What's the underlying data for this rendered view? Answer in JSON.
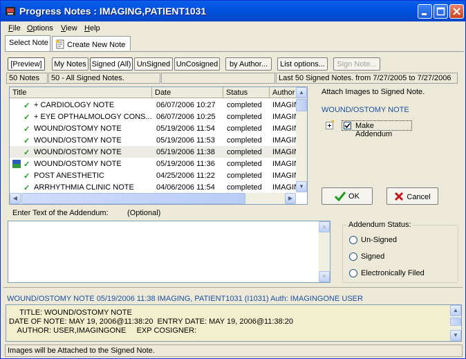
{
  "window": {
    "title": "Progress Notes : IMAGING,PATIENT1031"
  },
  "menu": [
    {
      "key": "F",
      "rest": "ile"
    },
    {
      "key": "O",
      "rest": "ptions"
    },
    {
      "key": "V",
      "rest": "iew"
    },
    {
      "key": "H",
      "rest": "elp"
    }
  ],
  "tabs": {
    "select_note": "Select Note",
    "create_new": "Create New Note"
  },
  "filter_buttons": {
    "preview": "[Preview]",
    "my_notes": "My Notes",
    "signed_all": "Signed (All)",
    "unsigned": "UnSigned",
    "uncosigned": "UnCosigned",
    "by_author": "by Author...",
    "list_options": "List options...",
    "sign_note": "Sign Note..."
  },
  "info": {
    "count": "50 Notes",
    "desc": "50 - All Signed Notes.",
    "range": "Last 50 Signed Notes.  from 7/27/2005 to 7/27/2006"
  },
  "columns": {
    "title": "Title",
    "date": "Date",
    "status": "Status",
    "author": "Author"
  },
  "notes": [
    {
      "title": "+ CARDIOLOGY NOTE",
      "date": "06/07/2006 10:27",
      "status": "completed",
      "author": "IMAGIN"
    },
    {
      "title": "+ EYE OPTHALMOLOGY CONS...",
      "date": "06/07/2006 10:25",
      "status": "completed",
      "author": "IMAGIN"
    },
    {
      "title": "WOUND/OSTOMY NOTE",
      "date": "05/19/2006 11:54",
      "status": "completed",
      "author": "IMAGIN"
    },
    {
      "title": "WOUND/OSTOMY NOTE",
      "date": "05/19/2006 11:53",
      "status": "completed",
      "author": "IMAGIN"
    },
    {
      "title": "WOUND/OSTOMY NOTE",
      "date": "05/19/2006 11:38",
      "status": "completed",
      "author": "IMAGIN"
    },
    {
      "title": "WOUND/OSTOMY NOTE",
      "date": "05/19/2006 11:36",
      "status": "completed",
      "author": "IMAGIN"
    },
    {
      "title": "POST ANESTHETIC",
      "date": "04/25/2006 11:22",
      "status": "completed",
      "author": "IMAGIN"
    },
    {
      "title": "ARRHYTHMIA CLINIC NOTE",
      "date": "04/06/2006 11:54",
      "status": "completed",
      "author": "IMAGIN"
    }
  ],
  "attach": {
    "heading": "Attach Images to Signed Note.",
    "note_title": "WOUND/OSTOMY NOTE",
    "addendum_label": "Make Addendum",
    "addendum_checked": true,
    "ok": "OK",
    "cancel": "Cancel"
  },
  "addendum": {
    "label": "Enter Text of the Addendum:",
    "optional": "(Optional)",
    "status_legend": "Addendum Status:",
    "options": [
      "Un-Signed",
      "Signed",
      "Electronically Filed"
    ]
  },
  "selected_note": {
    "summary": "WOUND/OSTOMY NOTE  05/19/2006 11:38  IMAGING, PATIENT1031  (I1031)  Auth: IMAGINGONE USER",
    "lines": [
      "     TITLE: WOUND/OSTOMY NOTE",
      "DATE OF NOTE: MAY 19, 2006@11:38:20  ENTRY DATE: MAY 19, 2006@11:38:20",
      "    AUTHOR: USER,IMAGINGONE     EXP COSIGNER:"
    ]
  },
  "status_bar": "Images will be Attached to the Signed Note.",
  "colors": {
    "title_bar": "#0053e0",
    "check": "#1a9b1a",
    "link": "#1b4fa0",
    "note_bg": "#f1efce"
  }
}
